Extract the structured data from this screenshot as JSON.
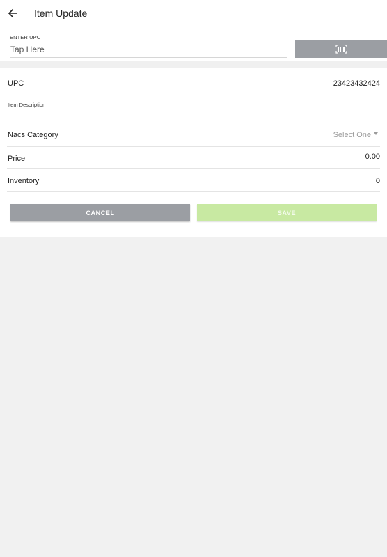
{
  "header": {
    "title": "Item Update"
  },
  "upc_entry": {
    "label": "ENTER UPC",
    "placeholder": "Tap Here",
    "value": ""
  },
  "colors": {
    "button_gray": "#9b9ea3",
    "save_green": "#c8e9a2",
    "background": "#f1f1f1"
  },
  "form": {
    "upc": {
      "label": "UPC",
      "value": "23423432424"
    },
    "description": {
      "label": "Item Description",
      "value": ""
    },
    "category": {
      "label": "Nacs Category",
      "value": "Select One"
    },
    "price": {
      "label": "Price",
      "value": "0.00"
    },
    "inventory": {
      "label": "Inventory",
      "value": "0"
    }
  },
  "actions": {
    "cancel_label": "CANCEL",
    "save_label": "SAVE"
  },
  "icons": {
    "back": "arrow-left-icon",
    "scan": "barcode-icon",
    "dropdown": "caret-down-icon"
  }
}
